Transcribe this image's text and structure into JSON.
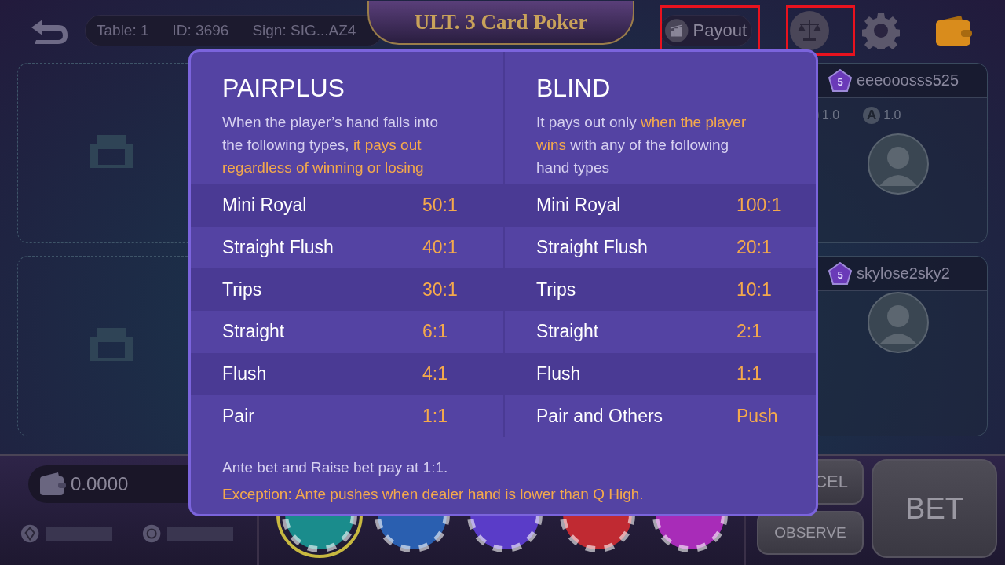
{
  "top_bar": {
    "table": "Table: 1",
    "id": "ID: 3696",
    "sign": "Sign: SIG...AZ4",
    "title": "ULT. 3 Card Poker",
    "payout_button": "Payout"
  },
  "players": [
    {
      "name": "eeeooosss525",
      "level": "5",
      "stats": [
        {
          "value": "1.0"
        },
        {
          "badge": "A",
          "value": "1.0"
        }
      ]
    },
    {
      "name": "skylose2sky2",
      "level": "5"
    }
  ],
  "modal": {
    "columns": [
      {
        "title": "PAIRPLUS",
        "description": [
          {
            "text": "When the player’s hand falls into the following types, ",
            "highlight": false
          },
          {
            "text": "it pays out regardless of winning or losing",
            "highlight": true
          }
        ],
        "rows": [
          {
            "hand": "Mini Royal",
            "payout": "50:1"
          },
          {
            "hand": "Straight Flush",
            "payout": "40:1"
          },
          {
            "hand": "Trips",
            "payout": "30:1"
          },
          {
            "hand": "Straight",
            "payout": "6:1"
          },
          {
            "hand": "Flush",
            "payout": "4:1"
          },
          {
            "hand": "Pair",
            "payout": "1:1"
          }
        ]
      },
      {
        "title": "BLIND",
        "description": [
          {
            "text": "It pays out only ",
            "highlight": false
          },
          {
            "text": "when the player wins",
            "highlight": true
          },
          {
            "text": " with any of the following hand types",
            "highlight": false
          }
        ],
        "rows": [
          {
            "hand": "Mini Royal",
            "payout": "100:1"
          },
          {
            "hand": "Straight Flush",
            "payout": "20:1"
          },
          {
            "hand": "Trips",
            "payout": "10:1"
          },
          {
            "hand": "Straight",
            "payout": "2:1"
          },
          {
            "hand": "Flush",
            "payout": "1:1"
          },
          {
            "hand": "Pair and Others",
            "payout": "Push"
          }
        ]
      }
    ],
    "note": "Ante bet and Raise bet pay at 1:1.",
    "exception": "Exception: Ante pushes when dealer hand is lower than Q High."
  },
  "bottom": {
    "balance": "0.0000",
    "chips": [
      {
        "color": "#1a8c8c",
        "selected": true
      },
      {
        "color": "#2a5fb0",
        "selected": false
      },
      {
        "color": "#5a3cc8",
        "selected": false
      },
      {
        "color": "#c02a32",
        "selected": false
      },
      {
        "color": "#a82cb8",
        "selected": false
      }
    ],
    "cancel_button": "CEL",
    "observe_button": "OBSERVE",
    "bet_button": "BET"
  }
}
